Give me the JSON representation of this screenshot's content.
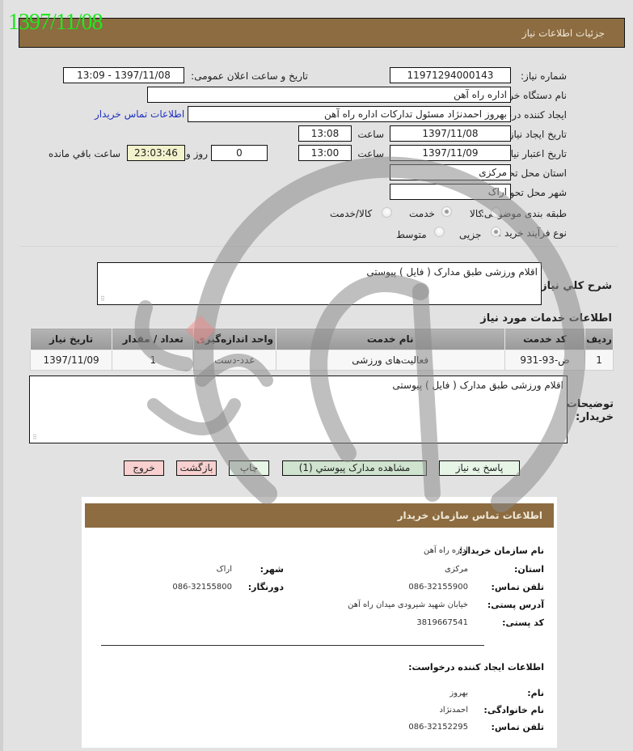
{
  "stamp_date": "1397/11/08",
  "header": {
    "title": "جزئیات اطلاعات نیاز"
  },
  "form": {
    "need_number": {
      "label": "شماره نیاز:",
      "value": "11971294000143"
    },
    "announce": {
      "label": "تاریخ و ساعت اعلان عمومی:",
      "value": "1397/11/08 - 13:09"
    },
    "buyer_org": {
      "label": "نام دستگاه خریدار:",
      "value": "اداره راه آهن"
    },
    "requester": {
      "label": "ایجاد کننده درخواست:",
      "value": "بهروز احمدنژاد مسئول تدارکات اداره راه آهن",
      "link": "اطلاعات تماس خریدار"
    },
    "created": {
      "label": "تاریخ ایجاد نیاز:",
      "date": "1397/11/08",
      "time_label": "ساعت",
      "time": "13:08"
    },
    "validity": {
      "label": "تاریخ اعتبار نیاز:",
      "date": "1397/11/09",
      "time_label": "ساعت",
      "time": "13:00",
      "days": "0",
      "days_label": "روز و",
      "remaining": "23:03:46",
      "remaining_label": "ساعت باقي مانده"
    },
    "province": {
      "label": "استان محل تحویل:",
      "value": "مرکزی"
    },
    "city": {
      "label": "شهر محل تحویل:",
      "value": "اراک"
    },
    "category": {
      "label": "طبقه بندی موضوعی:",
      "options": [
        "کالا",
        "خدمت",
        "کالا/خدمت"
      ],
      "selected": "خدمت"
    },
    "process": {
      "label": "نوع فرآیند خرید :",
      "options": [
        "جزیی",
        "متوسط"
      ],
      "selected": "جزیی"
    }
  },
  "summary": {
    "label": "شرح کلي نياز:",
    "value": "اقلام ورزشی طبق مدارک ( فایل ) پیوستی"
  },
  "services": {
    "title": "اطلاعات خدمات مورد نیاز",
    "columns": [
      "ردیف",
      "کد خدمت",
      "نام خدمت",
      "واحد اندازه‌گیری",
      "تعداد / مقدار",
      "تاریخ نیاز"
    ],
    "rows": [
      [
        "1",
        "ض-93-931",
        "فعالیت‌های ورزشی",
        "عدد-دست",
        "1",
        "1397/11/09"
      ]
    ]
  },
  "buyer_notes": {
    "label_1": "توضیحات",
    "label_2": "خریدار:",
    "value": "اقلام ورزشی طبق مدارک ( فایل ) پیوستی"
  },
  "buttons": {
    "reply": "پاسخ به نیاز",
    "attachments": "مشاهده مدارک پیوستي (1)",
    "print": "چاپ",
    "back": "بازگشت",
    "exit": "خروج"
  },
  "contact": {
    "title": "اطلاعات تماس سازمان خریدار",
    "org_label": "نام سازمان خریدار:",
    "org": "اداره راه آهن",
    "province_label": "استان:",
    "province": "مرکزی",
    "city_label": "شهر:",
    "city": "اراک",
    "phone_label": "تلفن تماس:",
    "phone": "086-32155900",
    "fax_label": "دورنگار:",
    "fax": "086-32155800",
    "address_label": "آدرس پستی:",
    "address": "خیابان شهید شیرودی میدان راه آهن",
    "postal_label": "کد پستی:",
    "postal": "3819667541",
    "creator_title": "اطلاعات ایجاد کننده درخواست:",
    "first_name_label": "نام:",
    "first_name": "بهروز",
    "last_name_label": "نام خانوادگی:",
    "last_name": "احمدنژاد",
    "creator_phone_label": "تلفن تماس:",
    "creator_phone": "086-32152295"
  },
  "colors": {
    "header_brown": "#8c6c40",
    "stamp_green": "#1fe81f",
    "link_blue": "#2030c0"
  }
}
